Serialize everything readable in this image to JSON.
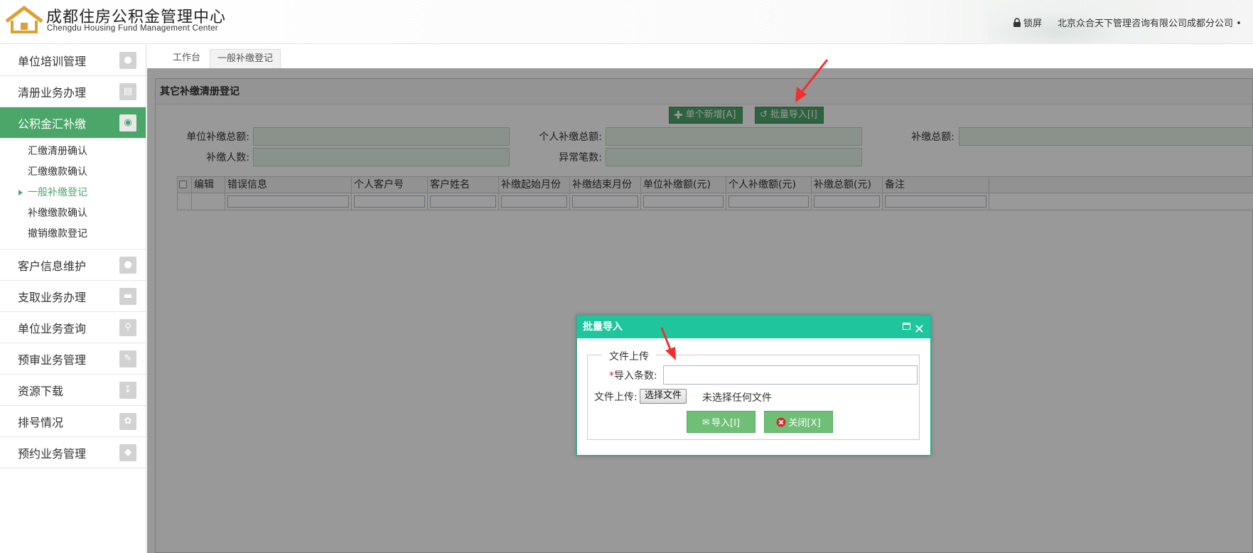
{
  "header": {
    "brand_cn": "成都住房公积金管理中心",
    "brand_en": "Chengdu  Housing Fund Management Center",
    "lock_label": "锁屏",
    "company": "北京众合天下管理咨询有限公司成都分公司 •"
  },
  "sidebar": {
    "items": [
      {
        "label": "单位培训管理",
        "icon": "chat-icon"
      },
      {
        "label": "清册业务办理",
        "icon": "document-icon"
      },
      {
        "label": "公积金汇补缴",
        "icon": "money-icon",
        "active": true
      },
      {
        "label": "客户信息维护",
        "icon": "user-icon"
      },
      {
        "label": "支取业务办理",
        "icon": "card-icon"
      },
      {
        "label": "单位业务查询",
        "icon": "search-icon"
      },
      {
        "label": "预审业务管理",
        "icon": "edit-icon"
      },
      {
        "label": "资源下载",
        "icon": "download-icon"
      },
      {
        "label": "排号情况",
        "icon": "leaf-icon"
      },
      {
        "label": "预约业务管理",
        "icon": "tag-icon"
      }
    ],
    "submenu": [
      "汇缴清册确认",
      "汇缴缴款确认",
      "一般补缴登记",
      "补缴缴款确认",
      "撤销缴款登记"
    ],
    "active_submenu": "一般补缴登记"
  },
  "tabs": [
    "工作台",
    "一般补缴登记"
  ],
  "panel": {
    "title": "其它补缴清册登记",
    "toolbar": {
      "add_label": "单个新增[A]",
      "import_label": "批量导入[I]"
    },
    "form": {
      "unit_total_label": "单位补缴总额:",
      "person_total_label": "个人补缴总额:",
      "total_label": "补缴总额:",
      "count_label": "补缴人数:",
      "abnormal_label": "异常笔数:"
    },
    "grid_columns": [
      "编辑",
      "错误信息",
      "个人客户号",
      "客户姓名",
      "补缴起始月份",
      "补缴结束月份",
      "单位补缴额(元)",
      "个人补缴额(元)",
      "补缴总额(元)",
      "备注"
    ]
  },
  "dialog": {
    "title": "批量导入",
    "legend": "文件上传",
    "required_mark": "*",
    "count_label": "导入条数:",
    "file_label": "文件上传:",
    "file_button": "选择文件",
    "file_none": "未选择任何文件",
    "import_button": "导入[I]",
    "close_button": "关闭[X]"
  },
  "colors": {
    "brand_green": "#4ba66a",
    "dialog_header": "#1fc59c",
    "dialog_button": "#6fbf77",
    "input_fill": "#e6f4ea",
    "arrow_red": "#f03030"
  }
}
